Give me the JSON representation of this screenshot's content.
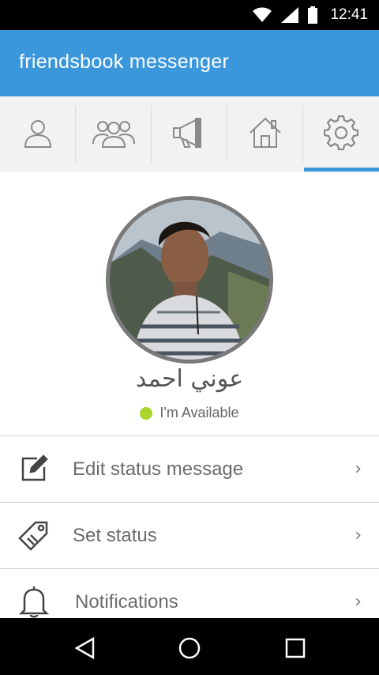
{
  "status_bar": {
    "time": "12:41",
    "wifi_icon": "wifi-icon",
    "signal_icon": "signal-icon",
    "battery_icon": "battery-icon"
  },
  "app_bar": {
    "title": "friendsbook messenger",
    "color": "#3b97dc"
  },
  "tabs": [
    {
      "icon": "person-icon",
      "selected": false
    },
    {
      "icon": "group-icon",
      "selected": false
    },
    {
      "icon": "megaphone-icon",
      "selected": false
    },
    {
      "icon": "home-icon",
      "selected": false
    },
    {
      "icon": "gear-icon",
      "selected": true
    }
  ],
  "profile": {
    "name": "عوني احمد",
    "status_text": "I'm Available",
    "status_color": "#a8d62a"
  },
  "menu": [
    {
      "label": "Edit status message",
      "icon": "edit-icon"
    },
    {
      "label": "Set status",
      "icon": "tag-icon"
    },
    {
      "label": "Notifications",
      "icon": "bell-icon"
    }
  ],
  "nav_bar": {
    "back_icon": "back-triangle-icon",
    "home_icon": "home-circle-icon",
    "recents_icon": "recents-square-icon"
  }
}
